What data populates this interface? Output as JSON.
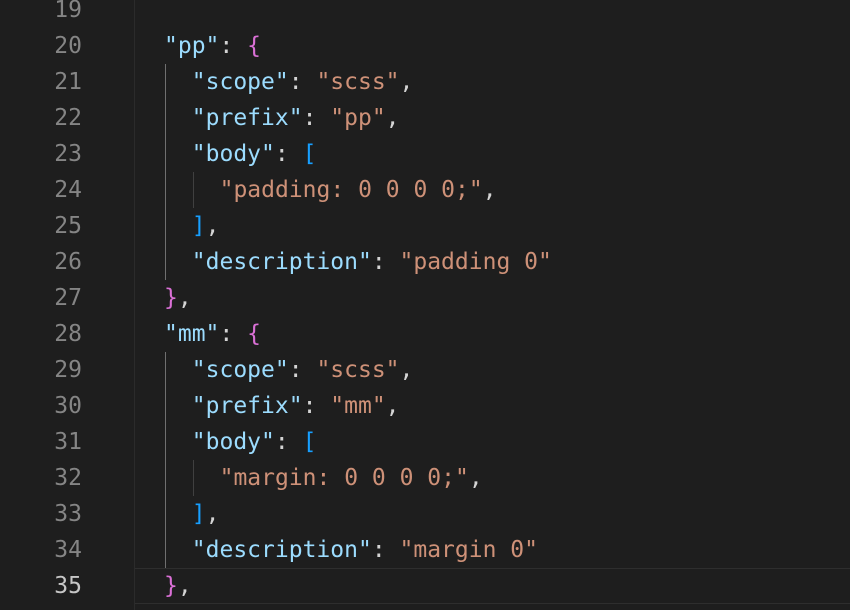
{
  "editor": {
    "current_line": 35,
    "lines": [
      {
        "n": "19",
        "indent": 0,
        "tokens": []
      },
      {
        "n": "20",
        "indent": 0,
        "tokens": [
          {
            "t": "\"pp\"",
            "c": "key"
          },
          {
            "t": ": ",
            "c": "pun"
          },
          {
            "t": "{",
            "c": "br1"
          }
        ]
      },
      {
        "n": "21",
        "indent": 1,
        "tokens": [
          {
            "t": "\"scope\"",
            "c": "key"
          },
          {
            "t": ": ",
            "c": "pun"
          },
          {
            "t": "\"scss\"",
            "c": "str"
          },
          {
            "t": ",",
            "c": "pun"
          }
        ]
      },
      {
        "n": "22",
        "indent": 1,
        "tokens": [
          {
            "t": "\"prefix\"",
            "c": "key"
          },
          {
            "t": ": ",
            "c": "pun"
          },
          {
            "t": "\"pp\"",
            "c": "str"
          },
          {
            "t": ",",
            "c": "pun"
          }
        ]
      },
      {
        "n": "23",
        "indent": 1,
        "tokens": [
          {
            "t": "\"body\"",
            "c": "key"
          },
          {
            "t": ": ",
            "c": "pun"
          },
          {
            "t": "[",
            "c": "br2"
          }
        ]
      },
      {
        "n": "24",
        "indent": 2,
        "tokens": [
          {
            "t": "\"padding: 0 0 0 0;\"",
            "c": "str"
          },
          {
            "t": ",",
            "c": "pun"
          }
        ]
      },
      {
        "n": "25",
        "indent": 1,
        "tokens": [
          {
            "t": "]",
            "c": "br2"
          },
          {
            "t": ",",
            "c": "pun"
          }
        ]
      },
      {
        "n": "26",
        "indent": 1,
        "tokens": [
          {
            "t": "\"description\"",
            "c": "key"
          },
          {
            "t": ": ",
            "c": "pun"
          },
          {
            "t": "\"padding 0\"",
            "c": "str"
          }
        ]
      },
      {
        "n": "27",
        "indent": 0,
        "tokens": [
          {
            "t": "}",
            "c": "br1"
          },
          {
            "t": ",",
            "c": "pun"
          }
        ]
      },
      {
        "n": "28",
        "indent": 0,
        "tokens": [
          {
            "t": "\"mm\"",
            "c": "key"
          },
          {
            "t": ": ",
            "c": "pun"
          },
          {
            "t": "{",
            "c": "br1"
          }
        ]
      },
      {
        "n": "29",
        "indent": 1,
        "tokens": [
          {
            "t": "\"scope\"",
            "c": "key"
          },
          {
            "t": ": ",
            "c": "pun"
          },
          {
            "t": "\"scss\"",
            "c": "str"
          },
          {
            "t": ",",
            "c": "pun"
          }
        ]
      },
      {
        "n": "30",
        "indent": 1,
        "tokens": [
          {
            "t": "\"prefix\"",
            "c": "key"
          },
          {
            "t": ": ",
            "c": "pun"
          },
          {
            "t": "\"mm\"",
            "c": "str"
          },
          {
            "t": ",",
            "c": "pun"
          }
        ]
      },
      {
        "n": "31",
        "indent": 1,
        "tokens": [
          {
            "t": "\"body\"",
            "c": "key"
          },
          {
            "t": ": ",
            "c": "pun"
          },
          {
            "t": "[",
            "c": "br2"
          }
        ]
      },
      {
        "n": "32",
        "indent": 2,
        "tokens": [
          {
            "t": "\"margin: 0 0 0 0;\"",
            "c": "str"
          },
          {
            "t": ",",
            "c": "pun"
          }
        ]
      },
      {
        "n": "33",
        "indent": 1,
        "tokens": [
          {
            "t": "]",
            "c": "br2"
          },
          {
            "t": ",",
            "c": "pun"
          }
        ]
      },
      {
        "n": "34",
        "indent": 1,
        "tokens": [
          {
            "t": "\"description\"",
            "c": "key"
          },
          {
            "t": ": ",
            "c": "pun"
          },
          {
            "t": "\"margin 0\"",
            "c": "str"
          }
        ]
      },
      {
        "n": "35",
        "indent": 0,
        "tokens": [
          {
            "t": "}",
            "c": "br1"
          },
          {
            "t": ",",
            "c": "pun"
          }
        ]
      }
    ]
  },
  "colors": {
    "background": "#1e1e1e",
    "line_number": "#858585",
    "line_number_active": "#c6c6c6",
    "key": "#9cdcfe",
    "string": "#ce9178",
    "punctuation": "#d4d4d4",
    "bracket_level_1": "#da70d6",
    "bracket_level_2": "#179fff"
  }
}
